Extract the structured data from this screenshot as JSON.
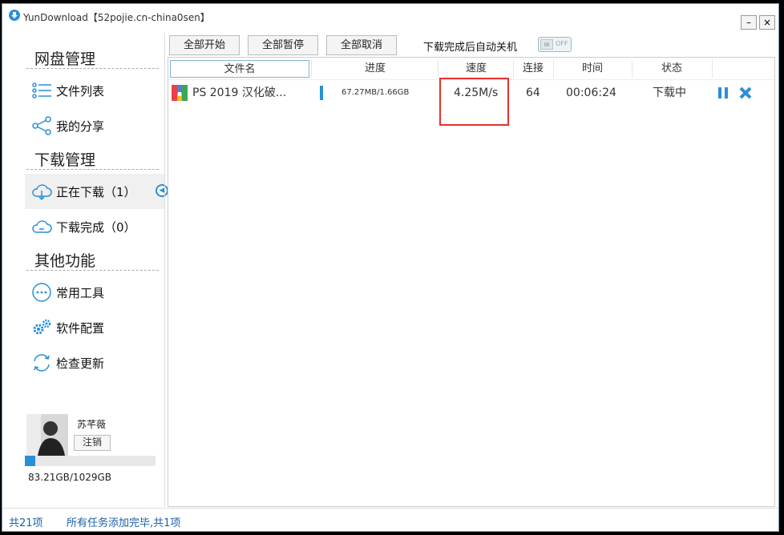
{
  "window": {
    "title": "YunDownload【52pojie.cn-china0sen】",
    "minimize": "–",
    "close": "×"
  },
  "sidebar": {
    "sections": [
      {
        "title": "网盘管理",
        "items": [
          {
            "label": "文件列表",
            "icon": "list-icon"
          },
          {
            "label": "我的分享",
            "icon": "share-icon"
          }
        ]
      },
      {
        "title": "下载管理",
        "items": [
          {
            "label": "正在下载（1）",
            "icon": "cloud-download-icon"
          },
          {
            "label": "下载完成（0）",
            "icon": "cloud-done-icon"
          }
        ]
      },
      {
        "title": "其他功能",
        "items": [
          {
            "label": "常用工具",
            "icon": "more-icon"
          },
          {
            "label": "软件配置",
            "icon": "gears-icon"
          },
          {
            "label": "检查更新",
            "icon": "refresh-icon"
          }
        ]
      }
    ],
    "user": {
      "name": "苏芊薇",
      "logout": "注销"
    },
    "storage": {
      "text": "83.21GB/1029GB",
      "used_fraction": 0.081
    }
  },
  "toolbar": {
    "start_all": "全部开始",
    "pause_all": "全部暂停",
    "cancel_all": "全部取消",
    "auto_shutdown_label": "下载完成后自动关机",
    "toggle": {
      "knob": "III",
      "state": "OFF"
    }
  },
  "table": {
    "columns": [
      "文件名",
      "进度",
      "速度",
      "连接",
      "时间",
      "状态"
    ],
    "rows": [
      {
        "name": "PS 2019 汉化破...",
        "progress": "67.27MB/1.66GB",
        "speed": "4.25M/s",
        "connections": "64",
        "time": "00:06:24",
        "status": "下载中"
      }
    ]
  },
  "status_bar": {
    "count": "共21项",
    "message": "所有任务添加完毕,共1项"
  },
  "colors": {
    "accent": "#2a8fd6",
    "highlight": "#e53030"
  }
}
